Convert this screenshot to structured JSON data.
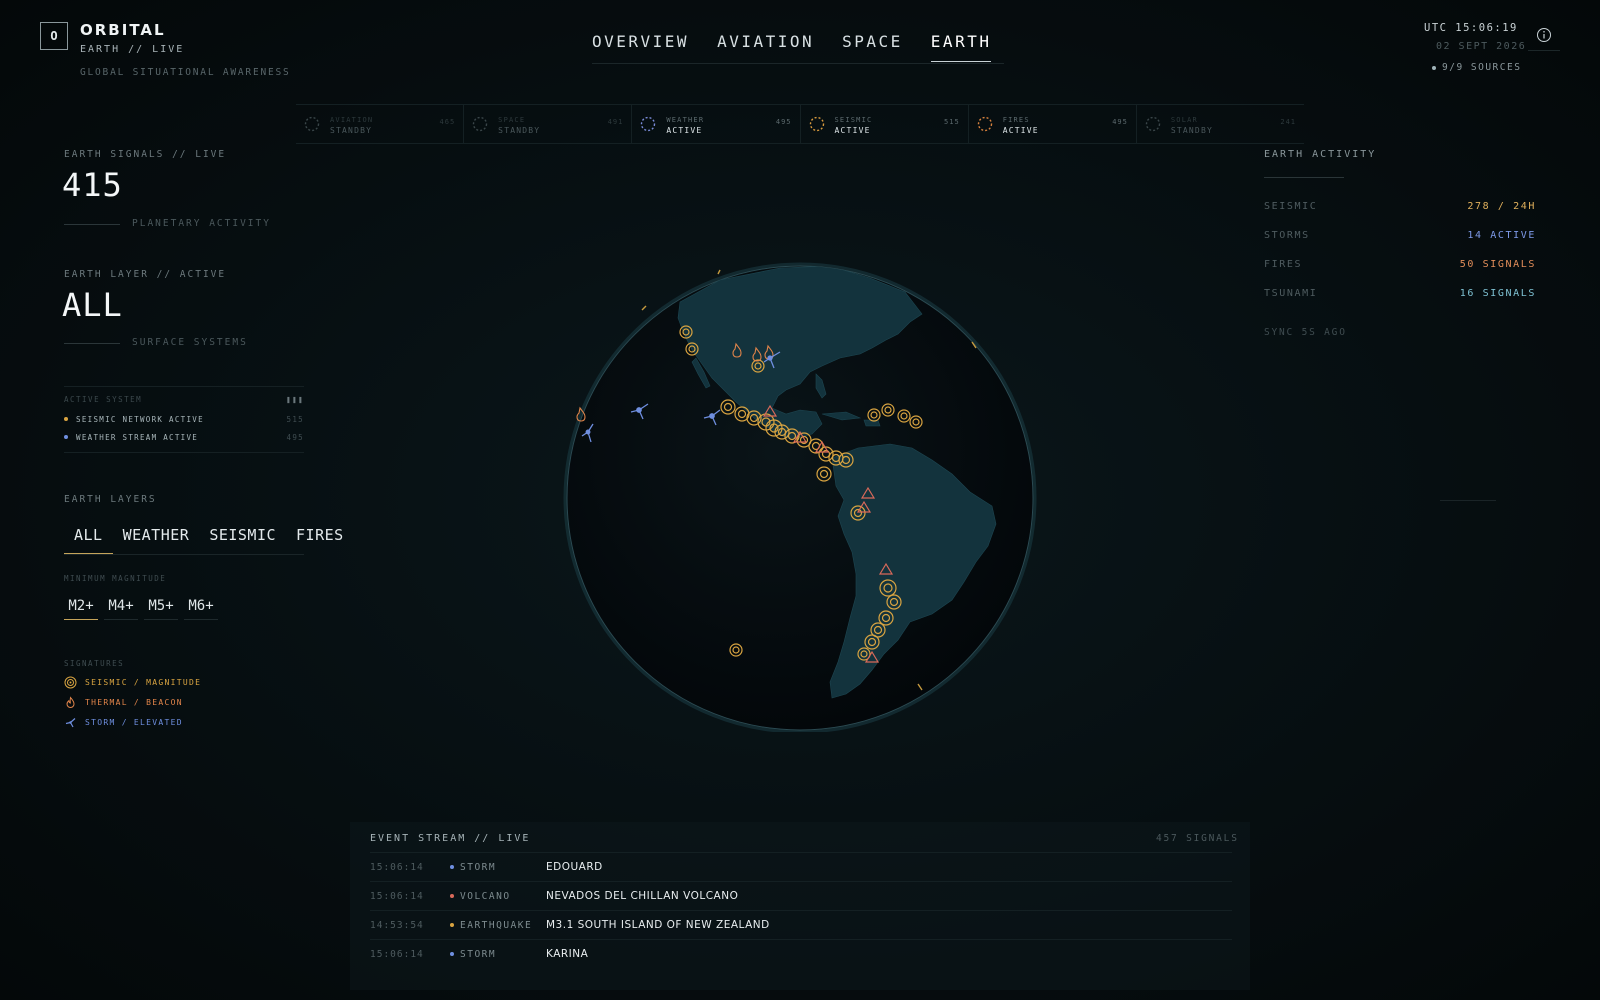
{
  "brand": {
    "logo_letter": "O",
    "name": "ORBITAL",
    "subtitle": "EARTH // LIVE",
    "tagline": "GLOBAL SITUATIONAL AWARENESS"
  },
  "nav": {
    "tabs": [
      {
        "label": "OVERVIEW",
        "active": false
      },
      {
        "label": "AVIATION",
        "active": false
      },
      {
        "label": "SPACE",
        "active": false
      },
      {
        "label": "EARTH",
        "active": true
      }
    ]
  },
  "clock": {
    "utc": "UTC 15:06:19",
    "date": "02 SEPT 2026",
    "sources": "9/9 SOURCES"
  },
  "status_bar": [
    {
      "name": "AVIATION",
      "state": "STANDBY",
      "count": "465",
      "active": false,
      "color": "#3a4649"
    },
    {
      "name": "SPACE",
      "state": "STANDBY",
      "count": "491",
      "active": false,
      "color": "#3a4649"
    },
    {
      "name": "WEATHER",
      "state": "ACTIVE",
      "count": "495",
      "active": true,
      "color": "#7a8bd8"
    },
    {
      "name": "SEISMIC",
      "state": "ACTIVE",
      "count": "515",
      "active": true,
      "color": "#d89a3e"
    },
    {
      "name": "FIRES",
      "state": "ACTIVE",
      "count": "495",
      "active": true,
      "color": "#d8823e"
    },
    {
      "name": "SOLAR",
      "state": "STANDBY",
      "count": "241",
      "active": false,
      "color": "#3a4649"
    }
  ],
  "left": {
    "signals_label": "EARTH SIGNALS // LIVE",
    "signals_value": "415",
    "signals_sub": "PLANETARY ACTIVITY",
    "layer_label": "EARTH LAYER // ACTIVE",
    "layer_value": "ALL",
    "layer_sub": "SURFACE SYSTEMS",
    "active_system": {
      "title": "ACTIVE SYSTEM",
      "pause": "❚❚❚",
      "rows": [
        {
          "label": "SEISMIC NETWORK ACTIVE",
          "count": "515",
          "color": "#d9a441"
        },
        {
          "label": "WEATHER STREAM ACTIVE",
          "count": "495",
          "color": "#6f8fe0"
        }
      ]
    },
    "layers_label": "EARTH LAYERS",
    "layer_tabs": [
      {
        "label": "ALL",
        "active": true
      },
      {
        "label": "WEATHER",
        "active": false
      },
      {
        "label": "SEISMIC",
        "active": false
      },
      {
        "label": "FIRES",
        "active": false
      }
    ],
    "magnitude_label": "MINIMUM MAGNITUDE",
    "magnitudes": [
      {
        "label": "M2+",
        "active": true
      },
      {
        "label": "M4+",
        "active": false
      },
      {
        "label": "M5+",
        "active": false
      },
      {
        "label": "M6+",
        "active": false
      }
    ],
    "signatures_label": "SIGNATURES",
    "signatures": [
      {
        "label": "SEISMIC / MAGNITUDE",
        "icon": "seismic-rings-icon",
        "color": "#d9a441"
      },
      {
        "label": "THERMAL / BEACON",
        "icon": "flame-icon",
        "color": "#e0844a"
      },
      {
        "label": "STORM / ELEVATED",
        "icon": "storm-icon",
        "color": "#6f8fe0"
      }
    ]
  },
  "right": {
    "title": "EARTH ACTIVITY",
    "rows": [
      {
        "key": "SEISMIC",
        "value": "278 / 24H",
        "color": "#e0b05c"
      },
      {
        "key": "STORMS",
        "value": "14 ACTIVE",
        "color": "#7e9ae8"
      },
      {
        "key": "FIRES",
        "value": "50 SIGNALS",
        "color": "#e38e5a"
      },
      {
        "key": "TSUNAMI",
        "value": "16 SIGNALS",
        "color": "#7fc2d3"
      }
    ],
    "sync": "SYNC 5S AGO"
  },
  "stream": {
    "title": "EVENT STREAM // LIVE",
    "count": "457 SIGNALS",
    "rows": [
      {
        "time": "15:06:14",
        "type": "STORM",
        "name": "EDOUARD",
        "color": "#6f8fe0"
      },
      {
        "time": "15:06:14",
        "type": "VOLCANO",
        "name": "NEVADOS DEL CHILLAN VOLCANO",
        "color": "#d9695a"
      },
      {
        "time": "14:53:54",
        "type": "EARTHQUAKE",
        "name": "M3.1 SOUTH ISLAND OF NEW ZEALAND",
        "color": "#d9a441"
      },
      {
        "time": "15:06:14",
        "type": "STORM",
        "name": "KARINA",
        "color": "#6f8fe0"
      }
    ]
  }
}
